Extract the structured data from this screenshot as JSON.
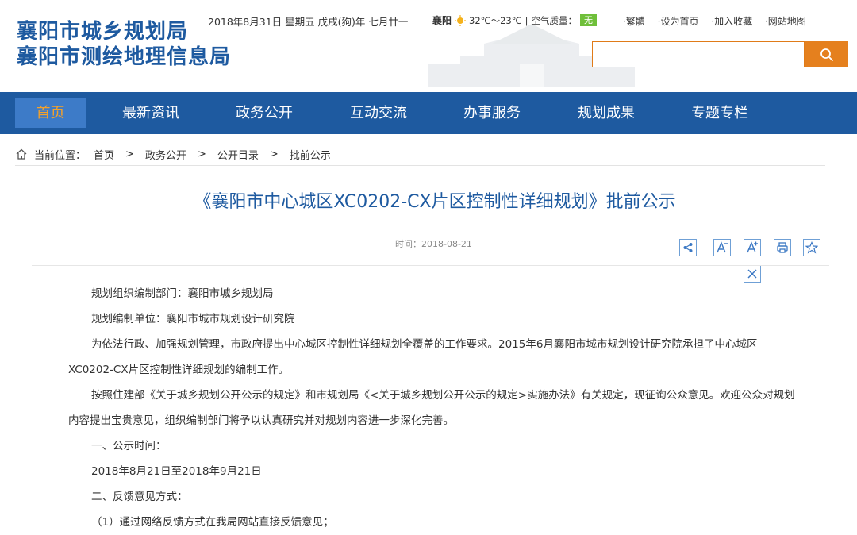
{
  "header": {
    "brand_line1": "襄阳市城乡规划局",
    "brand_line2": "襄阳市测绘地理信息局",
    "date": "2018年8月31日 星期五 戊戌(狗)年 七月廿一",
    "weather_city": "襄阳",
    "weather_temp": "32℃～23℃",
    "weather_sep": "|",
    "air_quality_label": "空气质量：",
    "air_quality_value": "无",
    "links": [
      "·繁體",
      "·设为首页",
      "·加入收藏",
      "·网站地图"
    ],
    "search_placeholder": "",
    "search_icon": "search-icon",
    "accent_color": "#e5801e",
    "brand_color": "#1e5aa0"
  },
  "nav": {
    "items": [
      "首页",
      "最新资讯",
      "政务公开",
      "互动交流",
      "办事服务",
      "规划成果",
      "专题专栏"
    ],
    "active_index": 0
  },
  "breadcrumb": {
    "label": "当前位置：",
    "items": [
      "首页",
      "政务公开",
      "公开目录",
      "批前公示"
    ],
    "separator": ">"
  },
  "article": {
    "title": "《襄阳市中心城区XC0202-CX片区控制性详细规划》批前公示",
    "time": "时间：2018-08-21",
    "tools": [
      "share-icon",
      "font-decrease-icon",
      "font-increase-icon",
      "print-icon",
      "favorite-icon",
      "close-icon"
    ],
    "paragraphs": [
      "规划组织编制部门：襄阳市城乡规划局",
      "规划编制单位：襄阳市城市规划设计研究院",
      "为依法行政、加强规划管理，市政府提出中心城区控制性详细规划全覆盖的工作要求。2015年6月襄阳市城市规划设计研究院承担了中心城区XC0202-CX片区控制性详细规划的编制工作。",
      "按照住建部《关于城乡规划公开公示的规定》和市规划局《<关于城乡规划公开公示的规定>实施办法》有关规定，现征询公众意见。欢迎公众对规划内容提出宝贵意见，组织编制部门将予以认真研究并对规划内容进一步深化完善。",
      "一、公示时间：",
      "2018年8月21日至2018年9月21日",
      "二、反馈意见方式：",
      "（1）通过网络反馈方式在我局网站直接反馈意见；"
    ]
  }
}
